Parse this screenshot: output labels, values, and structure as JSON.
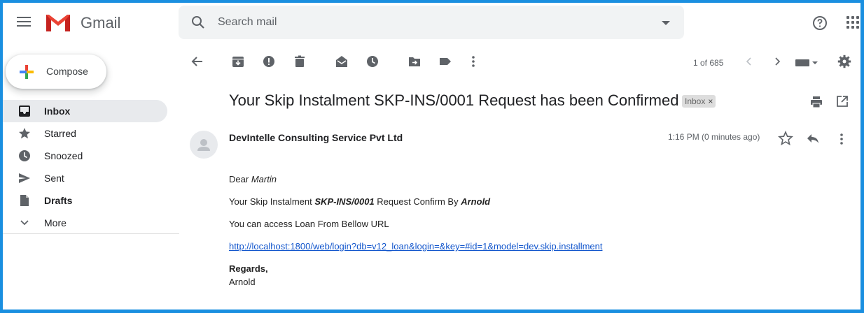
{
  "app": {
    "name": "Gmail",
    "brand_color": "#ea4335"
  },
  "search": {
    "placeholder": "Search mail"
  },
  "header": {
    "help_icon": "help-circle-icon",
    "apps_icon": "apps-grid-icon"
  },
  "compose": {
    "label": "Compose"
  },
  "sidebar": {
    "items": [
      {
        "label": "Inbox",
        "icon": "inbox-icon",
        "active": true
      },
      {
        "label": "Starred",
        "icon": "star-icon"
      },
      {
        "label": "Snoozed",
        "icon": "clock-icon"
      },
      {
        "label": "Sent",
        "icon": "send-icon"
      },
      {
        "label": "Drafts",
        "icon": "draft-icon"
      },
      {
        "label": "More",
        "icon": "chevron-down-icon"
      }
    ]
  },
  "toolbar": {
    "pager": "1 of 685",
    "icons": [
      "back-arrow-icon",
      "archive-icon",
      "report-spam-icon",
      "delete-icon",
      "mark-unread-icon",
      "snooze-icon",
      "move-to-icon",
      "label-icon",
      "more-vert-icon",
      "keyboard-icon",
      "settings-icon"
    ]
  },
  "message": {
    "subject": "Your Skip Instalment SKP-INS/0001 Request has been Confirmed",
    "label_chip": "Inbox",
    "sender": "DevIntelle Consulting Service Pvt Ltd",
    "time": "1:16 PM (0 minutes ago)",
    "greeting_prefix": "Dear",
    "recipient_name": "Martin",
    "line2_prefix": "Your Skip Instalment",
    "ref": "SKP-INS/0001",
    "line2_middle": "Request Confirm By",
    "confirmed_by": "Arnold",
    "line3": "You can access Loan From Bellow URL",
    "url": "http://localhost:1800/web/login?db=v12_loan&login=&key=#id=1&model=dev.skip.installment",
    "regards": "Regards,",
    "signature": "Arnold"
  }
}
